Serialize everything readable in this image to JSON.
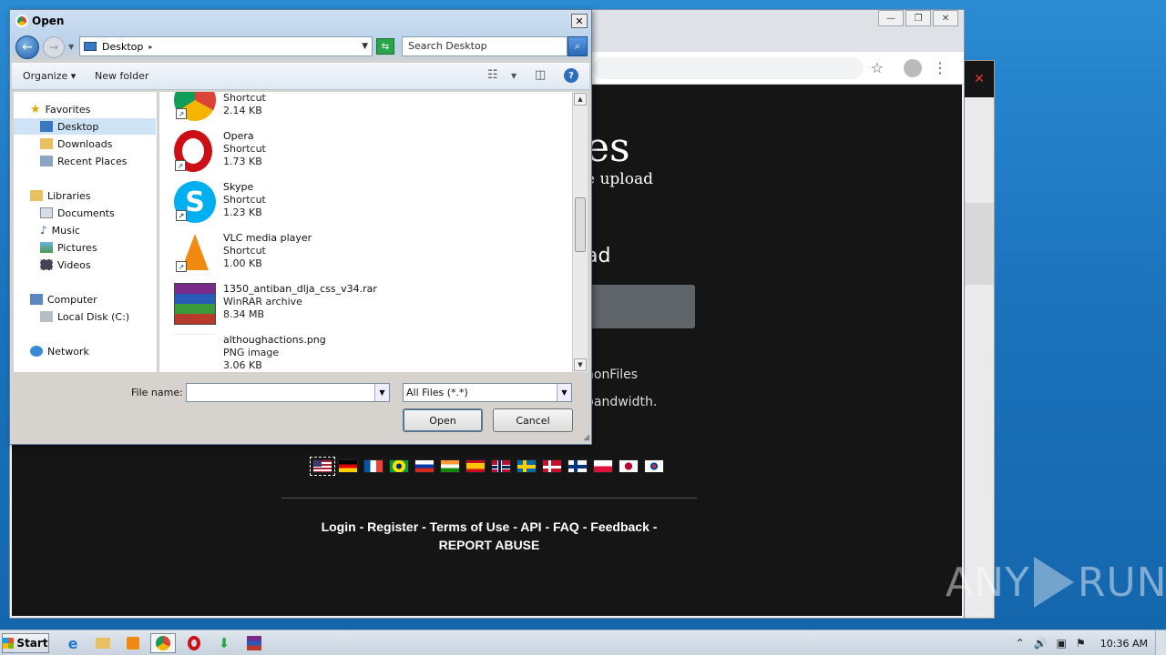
{
  "dialog": {
    "title": "Open",
    "address": "Desktop",
    "search_placeholder": "Search Desktop",
    "organize": "Organize",
    "new_folder": "New folder",
    "help": "?",
    "nav": {
      "favorites": "Favorites",
      "desktop": "Desktop",
      "downloads": "Downloads",
      "recent_places": "Recent Places",
      "libraries": "Libraries",
      "documents": "Documents",
      "music": "Music",
      "pictures": "Pictures",
      "videos": "Videos",
      "computer": "Computer",
      "local_disk": "Local Disk (C:)",
      "network": "Network"
    },
    "files": [
      {
        "name": "",
        "type": "Shortcut",
        "size": "2.14 KB",
        "icon": "chrome-icon"
      },
      {
        "name": "Opera",
        "type": "Shortcut",
        "size": "1.73 KB",
        "icon": "opera-icon"
      },
      {
        "name": "Skype",
        "type": "Shortcut",
        "size": "1.23 KB",
        "icon": "skype-icon"
      },
      {
        "name": "VLC media player",
        "type": "Shortcut",
        "size": "1.00 KB",
        "icon": "vlc-icon"
      },
      {
        "name": "1350_antiban_dlja_css_v34.rar",
        "type": "WinRAR archive",
        "size": "8.34 MB",
        "icon": "winrar-icon"
      },
      {
        "name": "althoughactions.png",
        "type": "PNG image",
        "size": "3.06 KB",
        "icon": "png-icon"
      }
    ],
    "file_name_label": "File name:",
    "file_name_value": "",
    "filter": "All Files (*.*)",
    "open_button": "Open",
    "cancel_button": "Cancel"
  },
  "page": {
    "logo_fragment": "es",
    "tagline_fragment": "e upload",
    "upload_fragment": "ad",
    "text_fragment_1": "nonFiles",
    "text_fragment_2": "bandwidth.",
    "flags": [
      "us",
      "de",
      "fr",
      "br",
      "ru",
      "in",
      "es",
      "no",
      "se",
      "dk",
      "fi",
      "pl",
      "jp",
      "kr"
    ],
    "links": {
      "login": "Login",
      "register": "Register",
      "terms": "Terms of Use",
      "api": "API",
      "faq": "FAQ",
      "feedback": "Feedback",
      "report": "REPORT ABUSE",
      "sep": "-"
    }
  },
  "taskbar": {
    "start": "Start",
    "clock": "10:36 AM"
  },
  "watermark": {
    "left": "ANY",
    "right": "RUN"
  },
  "colors": {
    "page_bg": "#151515",
    "desktop": "#1c74bd",
    "accent": "#2b6ec0"
  }
}
